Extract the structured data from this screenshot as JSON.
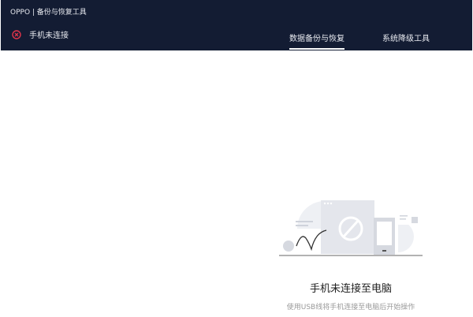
{
  "header": {
    "app_title": "OPPO | 备份与恢复工具",
    "connection_status": "手机未连接",
    "tabs": [
      {
        "label": "数据备份与恢复",
        "active": true
      },
      {
        "label": "系统降级工具",
        "active": false
      }
    ]
  },
  "empty_state": {
    "title": "手机未连接至电脑",
    "subtitle": "使用USB线将手机连接至电脑后开始操作"
  },
  "colors": {
    "header_bg": "#131c33",
    "error": "#e0344a"
  }
}
